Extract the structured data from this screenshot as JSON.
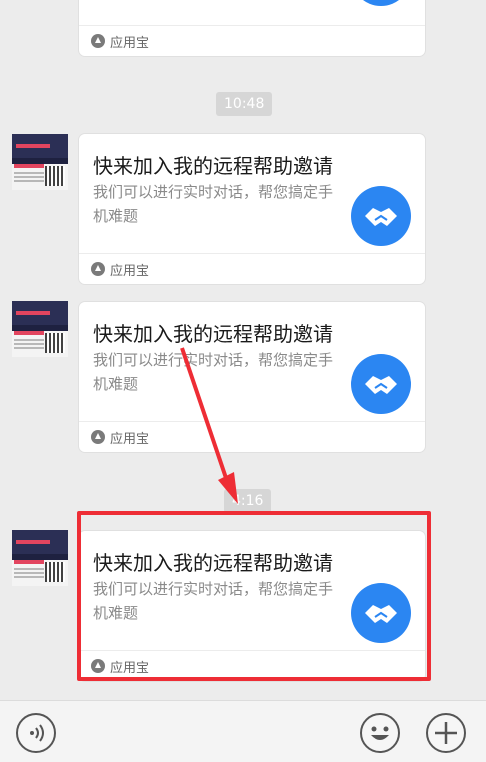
{
  "messages": [
    {
      "title": "快来加入我的远程帮助邀请",
      "desc": "我们可以进行实时对话，帮您搞定手机难题",
      "app": "应用宝"
    },
    {
      "title": "快来加入我的远程帮助邀请",
      "desc": "我们可以进行实时对话，帮您搞定手机难题",
      "app": "应用宝"
    },
    {
      "title": "快来加入我的远程帮助邀请",
      "desc": "我们可以进行实时对话，帮您搞定手机难题",
      "app": "应用宝"
    }
  ],
  "top_partial": {
    "app": "应用宝"
  },
  "timestamps": [
    "10:48",
    "4:16"
  ],
  "colors": {
    "accent": "#2b86f2",
    "highlight": "#ee2d35",
    "background": "#ececec"
  },
  "icons": {
    "card": "handshake-icon",
    "app": "app-store-icon",
    "voice": "voice-icon",
    "emoji": "emoji-icon",
    "add": "plus-icon"
  }
}
